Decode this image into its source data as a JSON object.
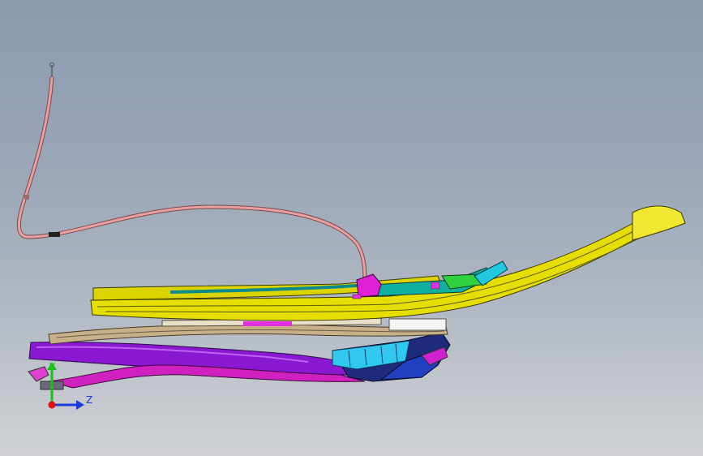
{
  "viewport": {
    "background_top": "#8b9bb0",
    "background_bottom": "#cfd1d4"
  },
  "triad": {
    "y_label": "Y",
    "z_label": "Z",
    "x_color": "#e01010",
    "y_color": "#18c018",
    "z_color": "#1a3cd8"
  },
  "model": {
    "colors": {
      "cable": "#e89a9a",
      "yellow": "#e8e000",
      "magenta": "#e020e0",
      "purple": "#9a20e0",
      "tan": "#c8b48c",
      "cyan": "#28d8f0",
      "teal": "#10a0a0",
      "navy": "#2a2a8a",
      "green": "#30d030"
    }
  }
}
